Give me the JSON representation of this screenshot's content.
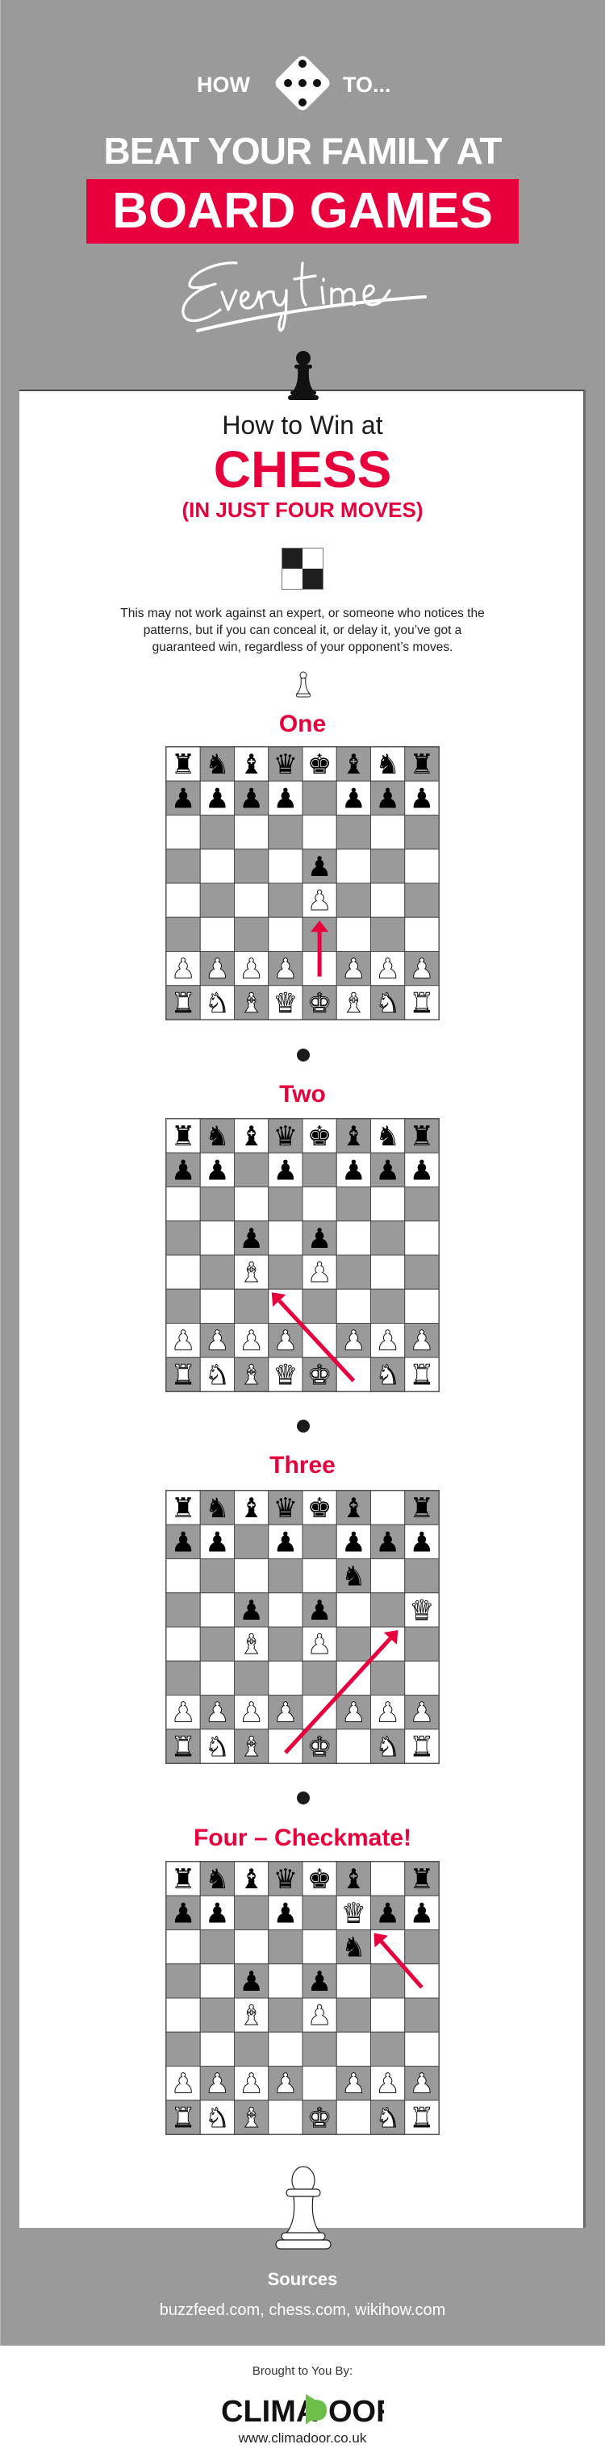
{
  "header": {
    "how": "HOW",
    "to": "TO...",
    "line1": "BEAT YOUR FAMILY AT",
    "line2": "BOARD GAMES",
    "script": "Every time",
    "accent_color": "#e8003d",
    "background_color": "#9a9a9a"
  },
  "intro": {
    "kicker": "How to Win at",
    "game": "CHESS",
    "subtitle": "(IN JUST FOUR MOVES)",
    "description": "This may not work against an expert, or someone who notices the patterns, but if you can conceal it, or delay it, you’ve got a guaranteed win, regardless of your opponent’s moves."
  },
  "steps": [
    {
      "title": "One",
      "position": [
        "rnbqkbnr",
        "pppp.ppp",
        "........",
        "....p...",
        "....P...",
        "........",
        "PPPP.PPP",
        "RNBQKBNR"
      ],
      "arrow": {
        "from": "e2",
        "to": "e3"
      }
    },
    {
      "title": "Two",
      "position": [
        "rnbqkbnr",
        "pp.p.ppp",
        "........",
        "..p.p...",
        "..B.P...",
        "........",
        "PPPP.PPP",
        "RNBQK.NR"
      ],
      "arrow": {
        "from": "f1",
        "to": "d3"
      }
    },
    {
      "title": "Three",
      "position": [
        "rnbqkb.r",
        "pp.p.ppp",
        ".....n..",
        "..p.p..Q",
        "..B.P...",
        "........",
        "PPPP.PPP",
        "RNB.K.NR"
      ],
      "arrow": {
        "from": "d1",
        "to": "g4"
      }
    },
    {
      "title": "Four – Checkmate!",
      "position": [
        "rnbqkb.r",
        "pp.p.Qpp",
        ".....n..",
        "..p.p...",
        "..B.P...",
        "........",
        "PPPP.PPP",
        "RNB.K.NR"
      ],
      "arrow": {
        "from": "h5",
        "to": "g6"
      }
    }
  ],
  "sources": {
    "title": "Sources",
    "list": "buzzfeed.com, chess.com, wikihow.com"
  },
  "footer": {
    "brought": "Brought to You By:",
    "brand_part1": "CLIMA",
    "brand_part2": "DOOR",
    "brand_green": "#6cc04a",
    "website": "www.climadoor.co.uk"
  }
}
